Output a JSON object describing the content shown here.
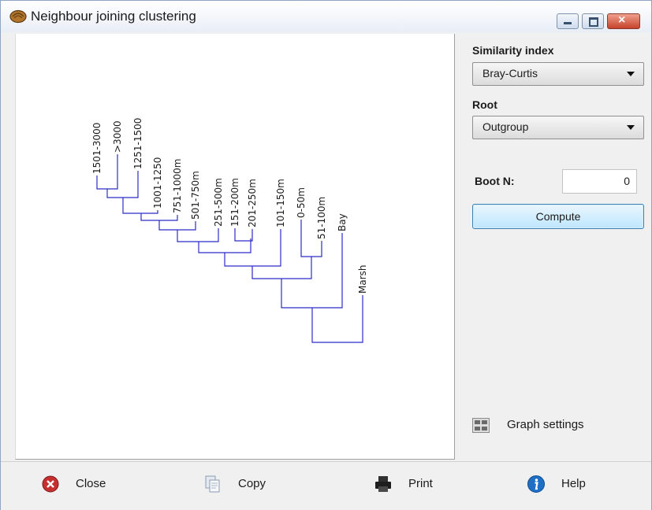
{
  "window": {
    "title": "Neighbour joining clustering"
  },
  "panel": {
    "similarity_label": "Similarity index",
    "similarity_value": "Bray-Curtis",
    "root_label": "Root",
    "root_value": "Outgroup",
    "boot_label": "Boot N:",
    "boot_value": "0",
    "compute_label": "Compute",
    "graph_settings_label": "Graph settings"
  },
  "toolbar": {
    "close_label": "Close",
    "copy_label": "Copy",
    "print_label": "Print",
    "help_label": "Help"
  },
  "tree": {
    "leaves": [
      "1501-3000",
      ">3000",
      "1251-1500",
      "1001-1250",
      "751-1000m",
      "501-750m",
      "251-500m",
      "151-200m",
      "201-250m",
      "101-150m",
      "0-50m",
      "51-100m",
      "Bay",
      "Marsh"
    ]
  },
  "colors": {
    "branch": "#2c2cc8",
    "compute_border": "#3c7fb1"
  },
  "icons": {
    "title": "fossil-shell-icon",
    "close": "close-circle-icon",
    "copy": "copy-icon",
    "print": "printer-icon",
    "help": "info-icon",
    "graph_settings": "grid-settings-icon"
  }
}
